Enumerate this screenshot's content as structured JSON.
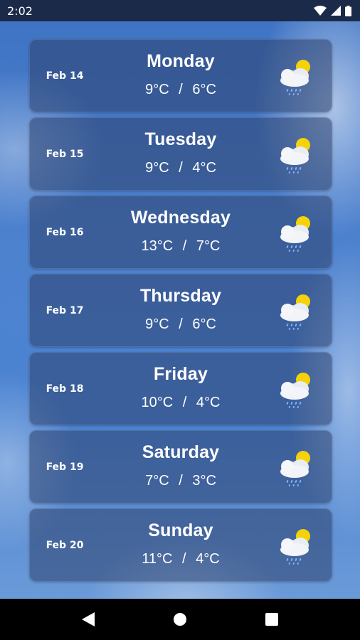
{
  "status_bar": {
    "time": "2:02"
  },
  "forecast": [
    {
      "date": "Feb 14",
      "day": "Monday",
      "high": "9°C",
      "low": "6°C",
      "icon": "sun-cloud-rain-icon"
    },
    {
      "date": "Feb 15",
      "day": "Tuesday",
      "high": "9°C",
      "low": "4°C",
      "icon": "sun-cloud-rain-icon"
    },
    {
      "date": "Feb 16",
      "day": "Wednesday",
      "high": "13°C",
      "low": "7°C",
      "icon": "sun-cloud-rain-icon"
    },
    {
      "date": "Feb 17",
      "day": "Thursday",
      "high": "9°C",
      "low": "6°C",
      "icon": "sun-cloud-rain-icon"
    },
    {
      "date": "Feb 18",
      "day": "Friday",
      "high": "10°C",
      "low": "4°C",
      "icon": "sun-cloud-rain-icon"
    },
    {
      "date": "Feb 19",
      "day": "Saturday",
      "high": "7°C",
      "low": "3°C",
      "icon": "sun-cloud-rain-icon"
    },
    {
      "date": "Feb 20",
      "day": "Sunday",
      "high": "11°C",
      "low": "4°C",
      "icon": "sun-cloud-rain-icon"
    }
  ],
  "temp_separator": "/",
  "colors": {
    "status_bar": "#1c2a4a",
    "card_bg": "#2e426e",
    "sun": "#f5d20a",
    "cloud": "#f2f4f7",
    "rain": "#7fb3ff",
    "nav_bar": "#000000"
  },
  "nav": {
    "back": "back-icon",
    "home": "home-icon",
    "recents": "recents-icon"
  }
}
